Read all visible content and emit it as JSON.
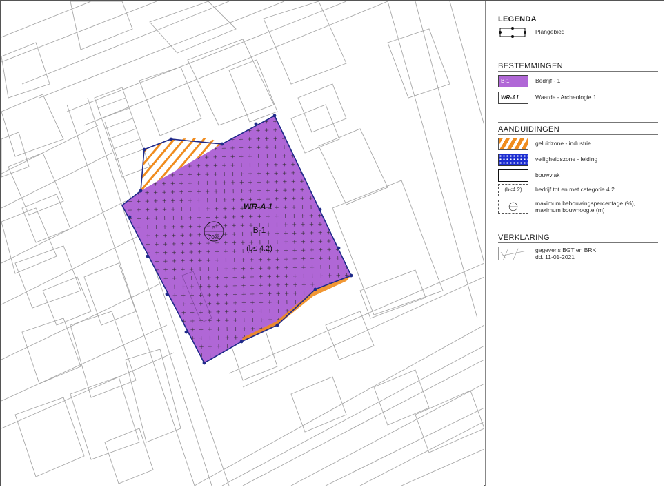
{
  "legend": {
    "title": "LEGENDA",
    "plangebied": "Plangebied",
    "bestemmingen_header": "BESTEMMINGEN",
    "b1_symbol": "B-1",
    "b1_label": "Bedrijf - 1",
    "wra1_symbol": "WR-A1",
    "wra1_label": "Waarde - Archeologie 1",
    "aanduidingen_header": "AANDUIDINGEN",
    "geluidzone_label": "geluidzone - industrie",
    "veiligheidszone_label": "veiligheidszone - leiding",
    "bouwvlak_label": "bouwvlak",
    "bedrijf_symbol": "(b≤4.2)",
    "bedrijf_label": "bedrijf tot en met categorie 4.2",
    "max_label_1": "maximum bebouwingspercentage (%),",
    "max_label_2": "maximum bouwhoogte (m)",
    "verklaring_header": "VERKLARING",
    "verklaring_line1": "gegevens BGT en BRK",
    "verklaring_line2": "dd. 11-01-2021"
  },
  "map": {
    "zone_label": "WR-A 1",
    "destination_label": "B-1",
    "category_label": "(b≤ 4.2)",
    "max_height": "5",
    "max_percentage": "70%"
  },
  "colors": {
    "bedrijf_fill": "#b067d6",
    "boundary": "#1f2a8a",
    "geluidzone": "#f08c1e",
    "veiligheidszone": "#1e2fd1",
    "basemap_line": "#a8a8a8"
  }
}
